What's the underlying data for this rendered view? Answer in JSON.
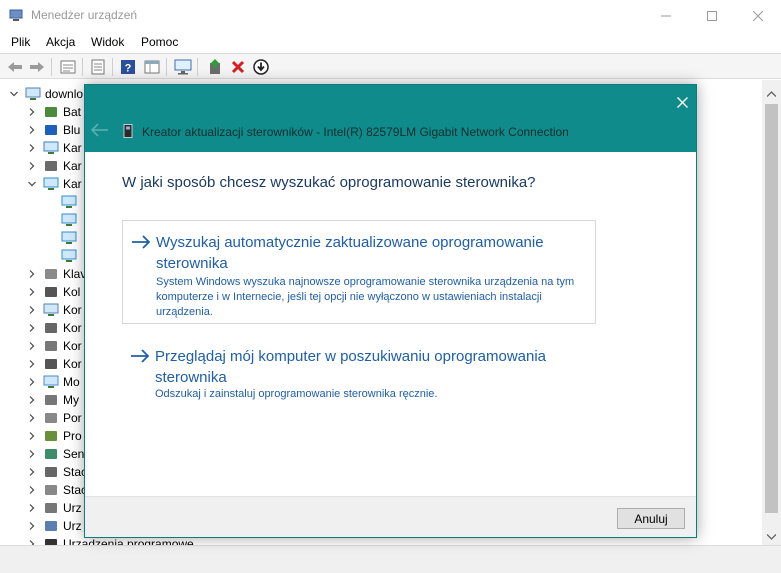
{
  "window": {
    "title": "Menedżer urządzeń"
  },
  "menu": [
    "Plik",
    "Akcja",
    "Widok",
    "Pomoc"
  ],
  "toolbar_icons": [
    "back-icon",
    "forward-icon",
    "properties-icon",
    "view-icon",
    "help-icon",
    "action-view-icon",
    "monitor-icon",
    "update-driver-icon",
    "uninstall-icon",
    "disable-icon"
  ],
  "tree": {
    "root": "downlo",
    "items": [
      {
        "label": "Bat",
        "icon": "battery-icon"
      },
      {
        "label": "Blu",
        "icon": "bluetooth-icon"
      },
      {
        "label": "Kar",
        "icon": "display-adapter-icon"
      },
      {
        "label": "Kar",
        "icon": "sound-card-icon"
      },
      {
        "label": "Kar",
        "icon": "network-adapter-icon",
        "expanded": true
      },
      {
        "label": "",
        "icon": "network-adapter-icon",
        "child": true
      },
      {
        "label": "",
        "icon": "network-adapter-icon",
        "child": true
      },
      {
        "label": "",
        "icon": "network-adapter-icon",
        "child": true
      },
      {
        "label": "",
        "icon": "network-adapter-icon",
        "child": true
      },
      {
        "label": "Klav",
        "icon": "keyboard-icon"
      },
      {
        "label": "Kol",
        "icon": "print-queue-icon"
      },
      {
        "label": "Kor",
        "icon": "computer-icon"
      },
      {
        "label": "Kor",
        "icon": "audio-icon"
      },
      {
        "label": "Kor",
        "icon": "ide-controller-icon"
      },
      {
        "label": "Kor",
        "icon": "usb-controller-icon"
      },
      {
        "label": "Mo",
        "icon": "monitor-icon"
      },
      {
        "label": "My",
        "icon": "mouse-icon"
      },
      {
        "label": "Por",
        "icon": "port-icon"
      },
      {
        "label": "Pro",
        "icon": "processor-icon"
      },
      {
        "label": "Sen",
        "icon": "sensor-icon"
      },
      {
        "label": "Stac",
        "icon": "disk-drive-icon"
      },
      {
        "label": "Stac",
        "icon": "dvd-drive-icon"
      },
      {
        "label": "Urz",
        "icon": "hid-icon"
      },
      {
        "label": "Urz",
        "icon": "system-device-icon"
      },
      {
        "label": "Urządzenia programowe",
        "icon": "software-device-icon"
      }
    ]
  },
  "dialog": {
    "title": "Kreator aktualizacji sterowników - Intel(R) 82579LM Gigabit Network Connection",
    "question": "W jaki sposób chcesz wyszukać oprogramowanie sterownika?",
    "options": [
      {
        "title": "Wyszukaj automatycznie zaktualizowane oprogramowanie sterownika",
        "description": "System Windows wyszuka najnowsze oprogramowanie sterownika urządzenia na tym komputerze i w Internecie, jeśli tej opcji nie wyłączono w ustawieniach instalacji urządzenia."
      },
      {
        "title": "Przeglądaj mój komputer w poszukiwaniu oprogramowania sterownika",
        "description": "Odszukaj i zainstaluj oprogramowanie sterownika ręcznie."
      }
    ],
    "cancel_label": "Anuluj"
  },
  "colors": {
    "dialog_header": "#108b8b",
    "link_blue": "#1e5eaa",
    "question_text": "#1a3a66"
  }
}
